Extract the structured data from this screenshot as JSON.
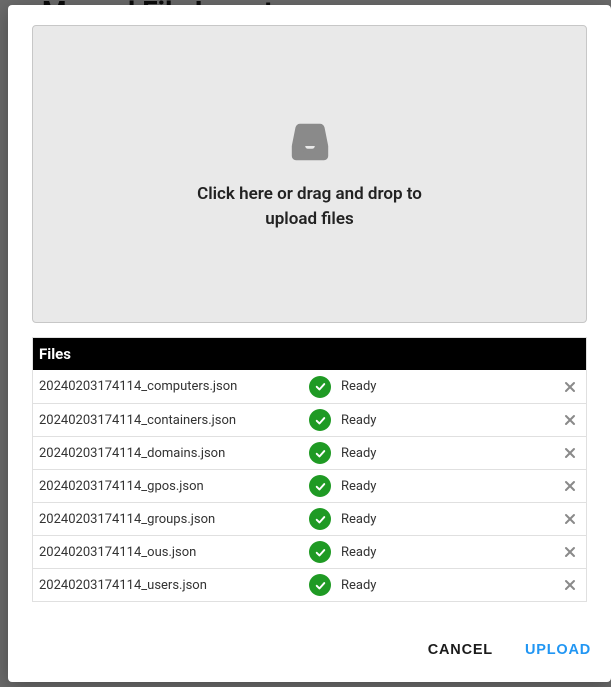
{
  "backdrop": {
    "title": "Manual File Ingest"
  },
  "dropzone": {
    "text": "Click here or drag and drop to upload files"
  },
  "files": {
    "header": "Files",
    "ready_label": "Ready",
    "items": [
      {
        "name": "20240203174114_computers.json",
        "status": "Ready"
      },
      {
        "name": "20240203174114_containers.json",
        "status": "Ready"
      },
      {
        "name": "20240203174114_domains.json",
        "status": "Ready"
      },
      {
        "name": "20240203174114_gpos.json",
        "status": "Ready"
      },
      {
        "name": "20240203174114_groups.json",
        "status": "Ready"
      },
      {
        "name": "20240203174114_ous.json",
        "status": "Ready"
      },
      {
        "name": "20240203174114_users.json",
        "status": "Ready"
      }
    ]
  },
  "actions": {
    "cancel": "CANCEL",
    "upload": "UPLOAD"
  }
}
